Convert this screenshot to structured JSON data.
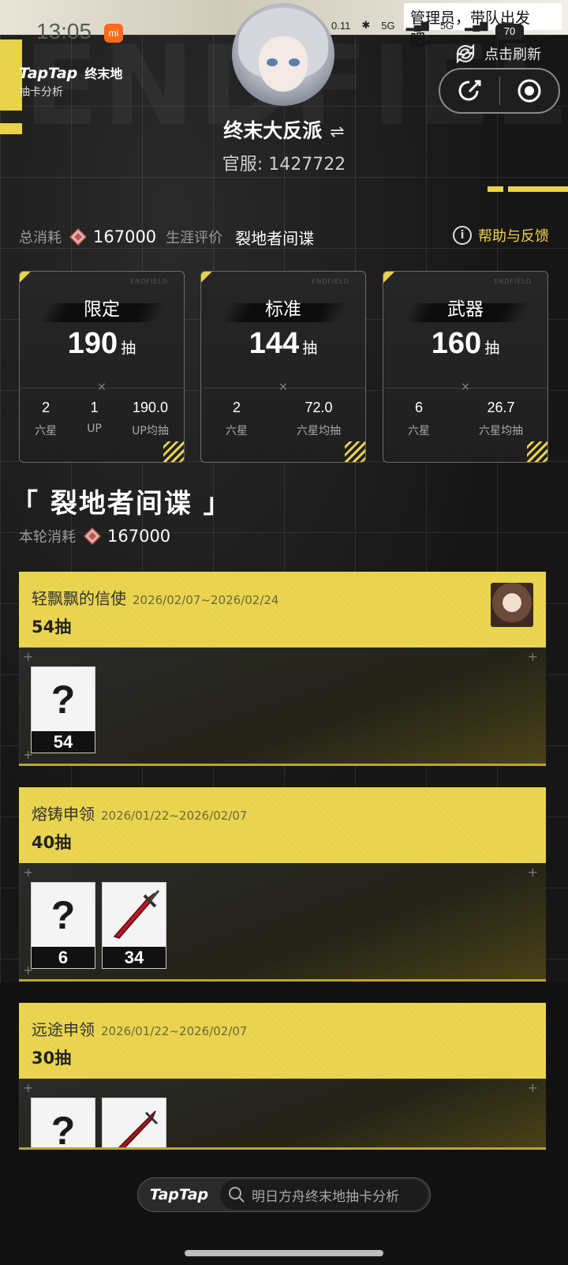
{
  "status_bar": {
    "time": "13:05",
    "network_speed": "0.11",
    "net1": "5G",
    "net2": "5G",
    "battery": "70",
    "notification_text": "管理员，带队出发吧。"
  },
  "header": {
    "logo_brand": "TapTap",
    "logo_game": "终末地",
    "logo_subtitle": "抽卡分析",
    "refresh_label": "点击刷新",
    "share_icon": "share-icon",
    "record_icon": "record-icon"
  },
  "profile": {
    "username": "终末大反派",
    "switch_icon": "⇌",
    "server": "官服: 1427722"
  },
  "summary": {
    "total_label": "总消耗",
    "total_value": "167000",
    "career_label": "生涯评价",
    "career_value": "裂地者间谍",
    "help_label": "帮助与反馈"
  },
  "cards": [
    {
      "title": "限定",
      "pulls": "190",
      "unit": "抽",
      "stats": [
        {
          "value": "2",
          "label": "六星"
        },
        {
          "value": "1",
          "label": "UP"
        },
        {
          "value": "190.0",
          "label": "UP均抽"
        }
      ]
    },
    {
      "title": "标准",
      "pulls": "144",
      "unit": "抽",
      "stats": [
        {
          "value": "2",
          "label": "六星"
        },
        {
          "value": "72.0",
          "label": "六星均抽"
        }
      ]
    },
    {
      "title": "武器",
      "pulls": "160",
      "unit": "抽",
      "stats": [
        {
          "value": "6",
          "label": "六星"
        },
        {
          "value": "26.7",
          "label": "六星均抽"
        }
      ]
    }
  ],
  "section": {
    "title": "「 裂地者间谍 」",
    "round_label": "本轮消耗",
    "round_value": "167000"
  },
  "banners": [
    {
      "name": "轻飘飘的信使",
      "date": "2026/02/07~2026/02/24",
      "pulls": "54抽",
      "items": [
        {
          "type": "unknown",
          "count": "54"
        }
      ]
    },
    {
      "name": "熔铸申领",
      "date": "2026/01/22~2026/02/07",
      "pulls": "40抽",
      "items": [
        {
          "type": "unknown",
          "count": "6"
        },
        {
          "type": "weapon",
          "count": "34"
        }
      ]
    },
    {
      "name": "远途申领",
      "date": "2026/01/22~2026/02/07",
      "pulls": "30抽",
      "items": [
        {
          "type": "unknown",
          "count": ""
        },
        {
          "type": "weapon",
          "count": ""
        }
      ]
    }
  ],
  "bottom_bar": {
    "brand": "TapTap",
    "search_text": "明日方舟终末地抽卡分析"
  },
  "colors": {
    "accent_yellow": "#e9d34c",
    "background": "#141414"
  }
}
